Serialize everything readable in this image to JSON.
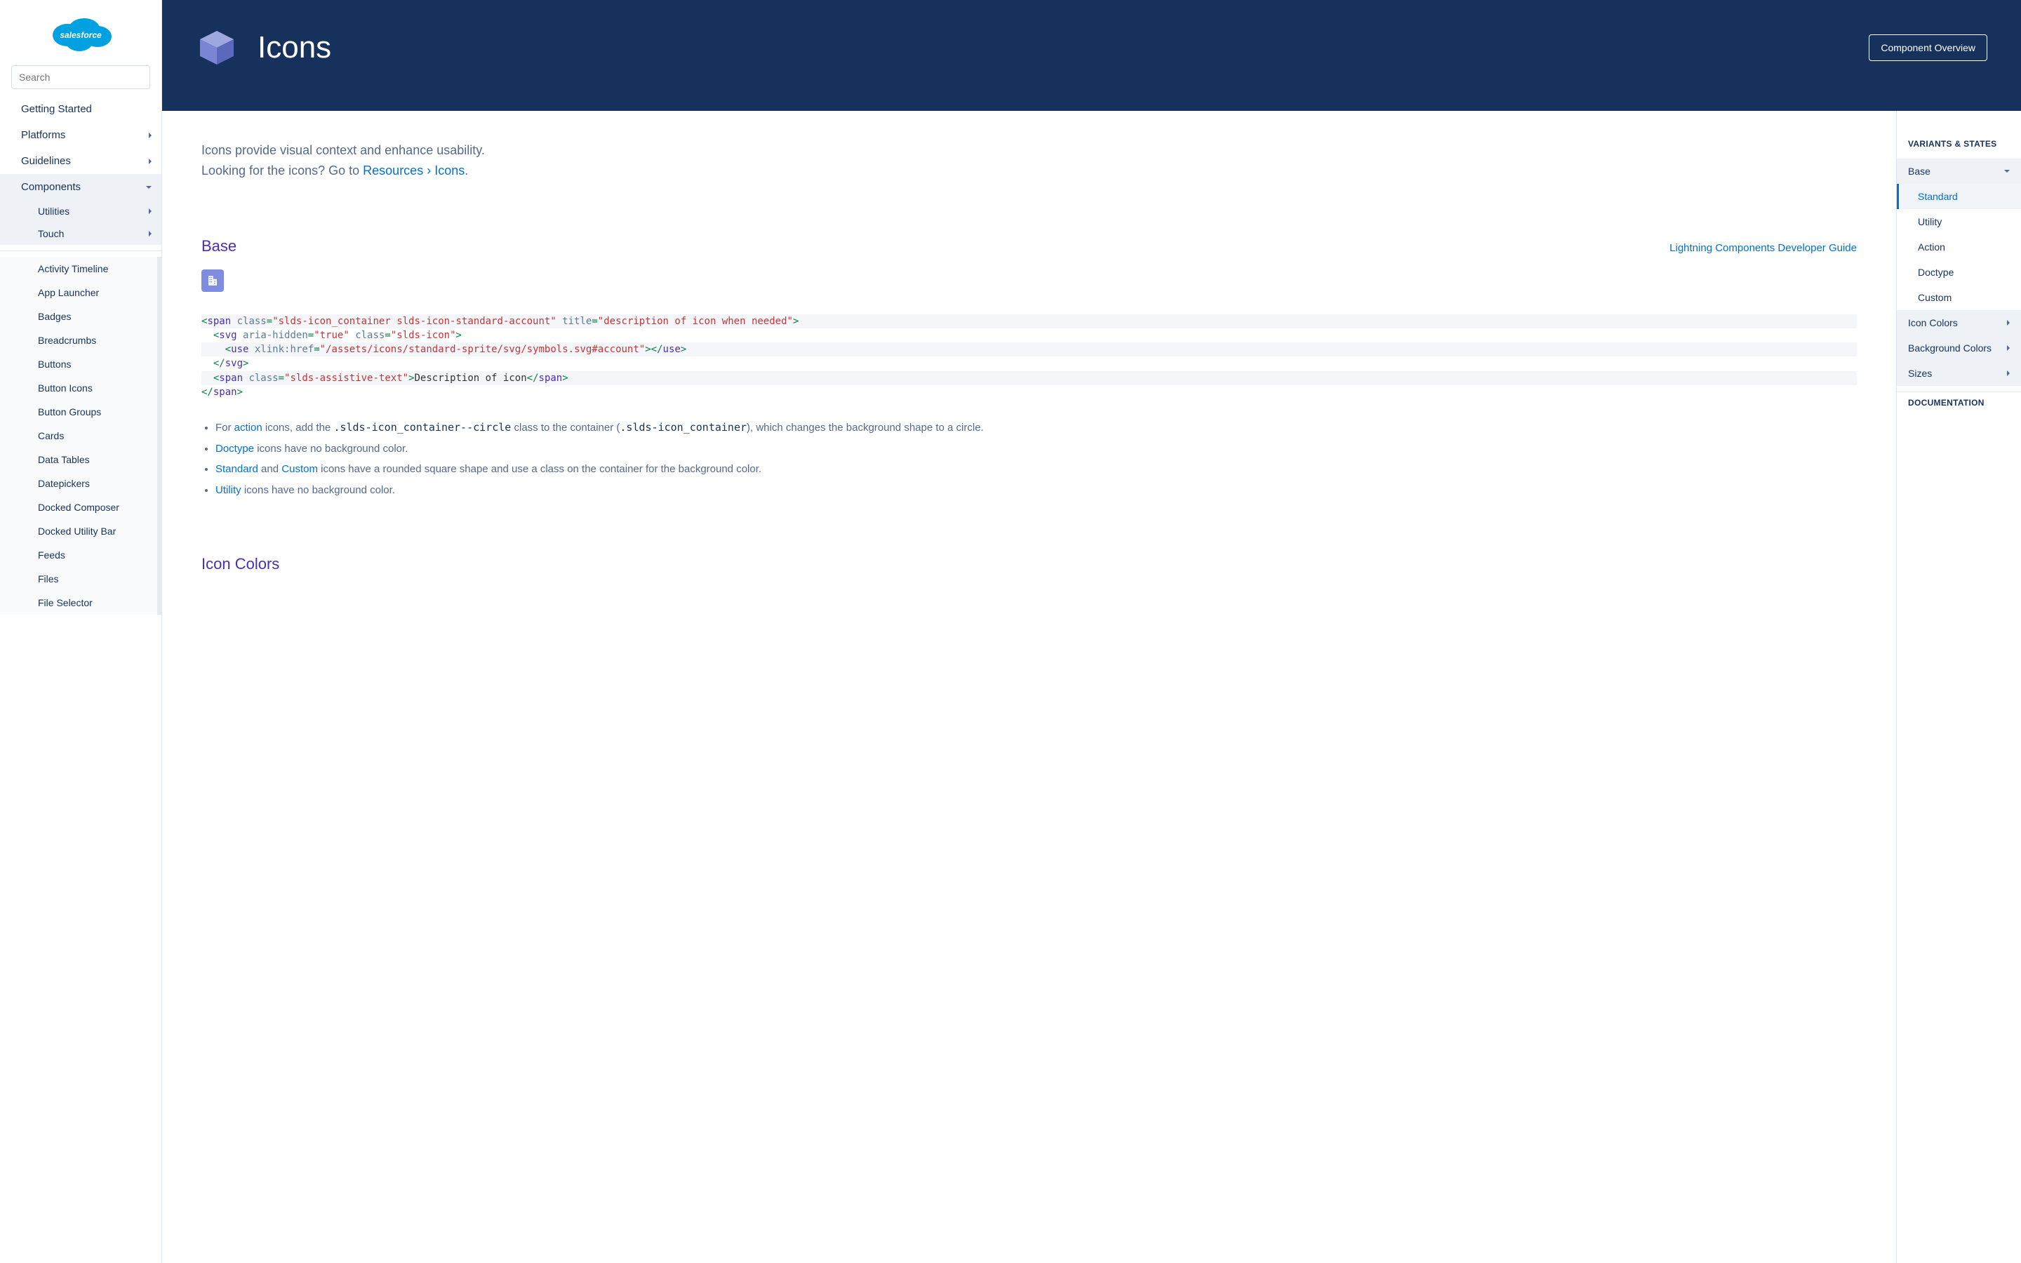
{
  "search": {
    "placeholder": "Search"
  },
  "sidebar": {
    "top": [
      {
        "label": "Getting Started",
        "arrow": ""
      },
      {
        "label": "Platforms",
        "arrow": "right"
      },
      {
        "label": "Guidelines",
        "arrow": "right"
      },
      {
        "label": "Components",
        "arrow": "down"
      }
    ],
    "subs": [
      {
        "label": "Utilities"
      },
      {
        "label": "Touch"
      }
    ],
    "components": [
      "Activity Timeline",
      "App Launcher",
      "Badges",
      "Breadcrumbs",
      "Buttons",
      "Button Icons",
      "Button Groups",
      "Cards",
      "Data Tables",
      "Datepickers",
      "Docked Composer",
      "Docked Utility Bar",
      "Feeds",
      "Files",
      "File Selector"
    ]
  },
  "header": {
    "title": "Icons",
    "overview_btn": "Component Overview"
  },
  "intro": {
    "line1": "Icons provide visual context and enhance usability.",
    "line2_prefix": "Looking for the icons? Go to ",
    "line2_link": "Resources › Icons",
    "line2_suffix": "."
  },
  "base": {
    "title": "Base",
    "dev_guide": "Lightning Components Developer Guide",
    "bullets": {
      "b0_pre": "For ",
      "b0_link": "action",
      "b0_mid": " icons, add the ",
      "b0_code1": ".slds-icon_container--circle",
      "b0_mid2": " class to the container (",
      "b0_code2": ".slds-icon_container",
      "b0_post": "), which changes the background shape to a circle.",
      "b1_link": "Doctype",
      "b1_text": " icons have no background color.",
      "b2_link1": "Standard",
      "b2_mid": " and ",
      "b2_link2": "Custom",
      "b2_text": " icons have a rounded square shape and use a class on the container for the background color.",
      "b3_link": "Utility",
      "b3_text": " icons have no background color."
    }
  },
  "code": {
    "l1_title": "description of icon when needed",
    "l3_href": "/assets/icons/standard-sprite/svg/symbols.svg#account",
    "l5_text": "Description of icon"
  },
  "section2": {
    "title": "Icon Colors"
  },
  "rightnav": {
    "title": "VARIANTS & STATES",
    "items": [
      {
        "label": "Base",
        "level": 1,
        "arrow": "down"
      },
      {
        "label": "Standard",
        "level": 2,
        "active": true
      },
      {
        "label": "Utility",
        "level": 2
      },
      {
        "label": "Action",
        "level": 2
      },
      {
        "label": "Doctype",
        "level": 2
      },
      {
        "label": "Custom",
        "level": 2
      },
      {
        "label": "Icon Colors",
        "level": 1,
        "arrow": "right"
      },
      {
        "label": "Background Colors",
        "level": 1,
        "arrow": "right"
      },
      {
        "label": "Sizes",
        "level": 1,
        "arrow": "right"
      }
    ],
    "doc": "DOCUMENTATION"
  }
}
